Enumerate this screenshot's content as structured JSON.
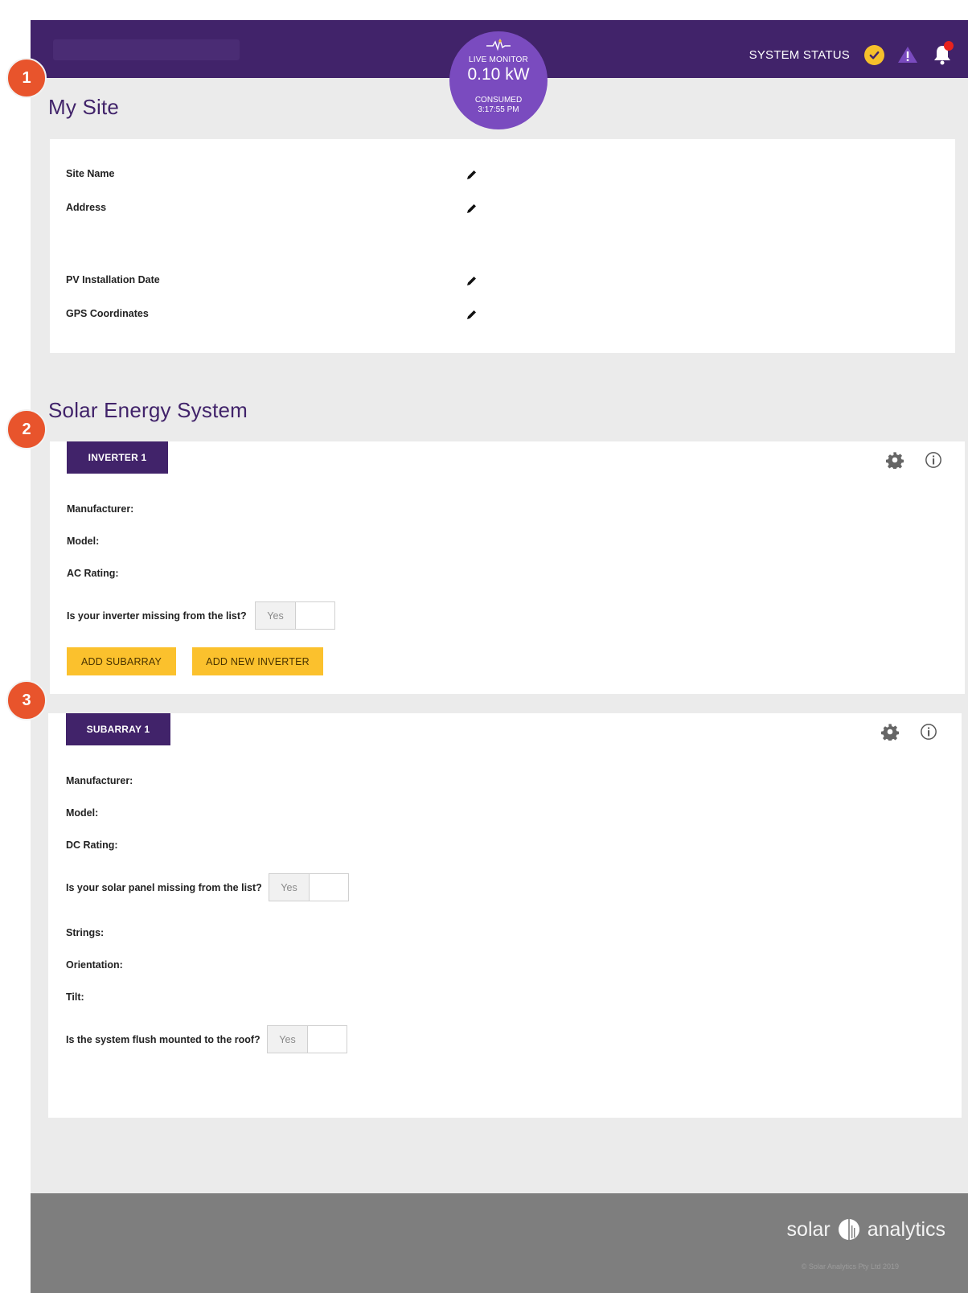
{
  "header": {
    "system_status_label": "SYSTEM STATUS",
    "status_icons": [
      "check-circle-icon",
      "warning-triangle-icon",
      "bell-icon"
    ]
  },
  "monitor": {
    "label": "LIVE MONITOR",
    "value": "0.10 kW",
    "consumed_label": "CONSUMED",
    "time": "3:17:55 PM"
  },
  "callouts": [
    "1",
    "2",
    "3"
  ],
  "my_site": {
    "title": "My Site",
    "fields": [
      {
        "label": "Site Name"
      },
      {
        "label": "Address"
      },
      {
        "label": "PV Installation Date"
      },
      {
        "label": "GPS Coordinates"
      }
    ]
  },
  "solar_system": {
    "title": "Solar Energy System",
    "inverter": {
      "tab": "INVERTER 1",
      "fields": [
        "Manufacturer:",
        "Model:",
        "AC Rating:"
      ],
      "missing_question": "Is your inverter missing from the list?",
      "toggle_yes": "Yes",
      "buttons": [
        "ADD SUBARRAY",
        "ADD NEW INVERTER"
      ]
    },
    "subarray": {
      "tab": "SUBARRAY 1",
      "fields": [
        "Manufacturer:",
        "Model:",
        "DC Rating:"
      ],
      "missing_question": "Is your solar panel missing from the list?",
      "toggle_yes": "Yes",
      "fields2": [
        "Strings:",
        "Orientation:",
        "Tilt:"
      ],
      "flush_question": "Is the system flush mounted to the roof?",
      "flush_toggle_yes": "Yes"
    }
  },
  "footer": {
    "brand_left": "solar",
    "brand_right": "analytics",
    "copyright": "© Solar Analytics Pty Ltd 2019"
  },
  "colors": {
    "header": "#41236a",
    "monitor": "#7a4bbf",
    "accent_button": "#fbc12d",
    "callout": "#e8542c",
    "background": "#ebebeb",
    "footer": "#7e7e7e"
  }
}
